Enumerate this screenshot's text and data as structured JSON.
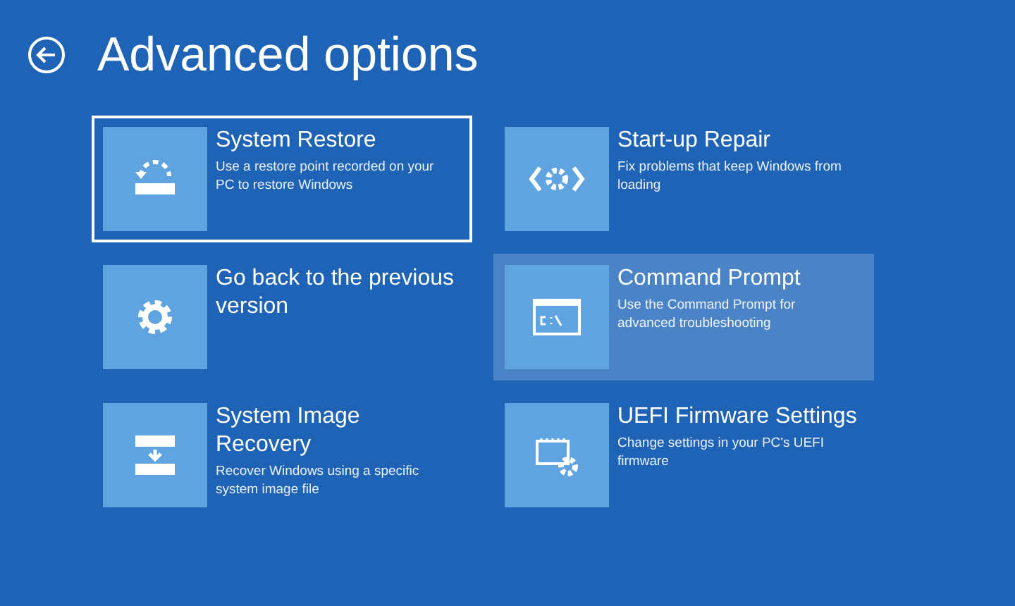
{
  "title": "Advanced options",
  "options": [
    {
      "title": "System Restore",
      "description": "Use a restore point recorded on your PC to restore Windows",
      "selected": true,
      "hovered": false
    },
    {
      "title": "Start-up Repair",
      "description": "Fix problems that keep Windows from loading",
      "selected": false,
      "hovered": false
    },
    {
      "title": "Go back to the previous version",
      "selected": false,
      "hovered": false
    },
    {
      "title": "Command Prompt",
      "description": "Use the Command Prompt for advanced troubleshooting",
      "selected": false,
      "hovered": true
    },
    {
      "title": "System Image Recovery",
      "description": "Recover Windows using a specific system image file",
      "selected": false,
      "hovered": false
    },
    {
      "title": "UEFI Firmware Settings",
      "description": "Change settings in your PC's UEFI firmware",
      "selected": false,
      "hovered": false
    }
  ]
}
